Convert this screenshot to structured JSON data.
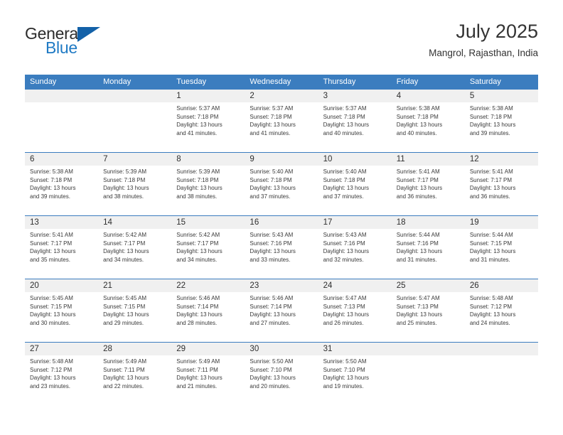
{
  "brand": {
    "name_part1": "General",
    "name_part2": "Blue",
    "triangle_color": "#1361a8",
    "blue_color": "#1f7ac4"
  },
  "header": {
    "title": "July 2025",
    "subtitle": "Mangrol, Rajasthan, India"
  },
  "theme": {
    "header_blue": "#3b7dbf",
    "daynum_band": "#f0f0f0",
    "text": "#333333"
  },
  "weekdays": [
    "Sunday",
    "Monday",
    "Tuesday",
    "Wednesday",
    "Thursday",
    "Friday",
    "Saturday"
  ],
  "weeks": [
    {
      "days": [
        {
          "num": "",
          "sunrise": "",
          "sunset": "",
          "daylight1": "",
          "daylight2": ""
        },
        {
          "num": "",
          "sunrise": "",
          "sunset": "",
          "daylight1": "",
          "daylight2": ""
        },
        {
          "num": "1",
          "sunrise": "Sunrise: 5:37 AM",
          "sunset": "Sunset: 7:18 PM",
          "daylight1": "Daylight: 13 hours",
          "daylight2": "and 41 minutes."
        },
        {
          "num": "2",
          "sunrise": "Sunrise: 5:37 AM",
          "sunset": "Sunset: 7:18 PM",
          "daylight1": "Daylight: 13 hours",
          "daylight2": "and 41 minutes."
        },
        {
          "num": "3",
          "sunrise": "Sunrise: 5:37 AM",
          "sunset": "Sunset: 7:18 PM",
          "daylight1": "Daylight: 13 hours",
          "daylight2": "and 40 minutes."
        },
        {
          "num": "4",
          "sunrise": "Sunrise: 5:38 AM",
          "sunset": "Sunset: 7:18 PM",
          "daylight1": "Daylight: 13 hours",
          "daylight2": "and 40 minutes."
        },
        {
          "num": "5",
          "sunrise": "Sunrise: 5:38 AM",
          "sunset": "Sunset: 7:18 PM",
          "daylight1": "Daylight: 13 hours",
          "daylight2": "and 39 minutes."
        }
      ]
    },
    {
      "days": [
        {
          "num": "6",
          "sunrise": "Sunrise: 5:38 AM",
          "sunset": "Sunset: 7:18 PM",
          "daylight1": "Daylight: 13 hours",
          "daylight2": "and 39 minutes."
        },
        {
          "num": "7",
          "sunrise": "Sunrise: 5:39 AM",
          "sunset": "Sunset: 7:18 PM",
          "daylight1": "Daylight: 13 hours",
          "daylight2": "and 38 minutes."
        },
        {
          "num": "8",
          "sunrise": "Sunrise: 5:39 AM",
          "sunset": "Sunset: 7:18 PM",
          "daylight1": "Daylight: 13 hours",
          "daylight2": "and 38 minutes."
        },
        {
          "num": "9",
          "sunrise": "Sunrise: 5:40 AM",
          "sunset": "Sunset: 7:18 PM",
          "daylight1": "Daylight: 13 hours",
          "daylight2": "and 37 minutes."
        },
        {
          "num": "10",
          "sunrise": "Sunrise: 5:40 AM",
          "sunset": "Sunset: 7:18 PM",
          "daylight1": "Daylight: 13 hours",
          "daylight2": "and 37 minutes."
        },
        {
          "num": "11",
          "sunrise": "Sunrise: 5:41 AM",
          "sunset": "Sunset: 7:17 PM",
          "daylight1": "Daylight: 13 hours",
          "daylight2": "and 36 minutes."
        },
        {
          "num": "12",
          "sunrise": "Sunrise: 5:41 AM",
          "sunset": "Sunset: 7:17 PM",
          "daylight1": "Daylight: 13 hours",
          "daylight2": "and 36 minutes."
        }
      ]
    },
    {
      "days": [
        {
          "num": "13",
          "sunrise": "Sunrise: 5:41 AM",
          "sunset": "Sunset: 7:17 PM",
          "daylight1": "Daylight: 13 hours",
          "daylight2": "and 35 minutes."
        },
        {
          "num": "14",
          "sunrise": "Sunrise: 5:42 AM",
          "sunset": "Sunset: 7:17 PM",
          "daylight1": "Daylight: 13 hours",
          "daylight2": "and 34 minutes."
        },
        {
          "num": "15",
          "sunrise": "Sunrise: 5:42 AM",
          "sunset": "Sunset: 7:17 PM",
          "daylight1": "Daylight: 13 hours",
          "daylight2": "and 34 minutes."
        },
        {
          "num": "16",
          "sunrise": "Sunrise: 5:43 AM",
          "sunset": "Sunset: 7:16 PM",
          "daylight1": "Daylight: 13 hours",
          "daylight2": "and 33 minutes."
        },
        {
          "num": "17",
          "sunrise": "Sunrise: 5:43 AM",
          "sunset": "Sunset: 7:16 PM",
          "daylight1": "Daylight: 13 hours",
          "daylight2": "and 32 minutes."
        },
        {
          "num": "18",
          "sunrise": "Sunrise: 5:44 AM",
          "sunset": "Sunset: 7:16 PM",
          "daylight1": "Daylight: 13 hours",
          "daylight2": "and 31 minutes."
        },
        {
          "num": "19",
          "sunrise": "Sunrise: 5:44 AM",
          "sunset": "Sunset: 7:15 PM",
          "daylight1": "Daylight: 13 hours",
          "daylight2": "and 31 minutes."
        }
      ]
    },
    {
      "days": [
        {
          "num": "20",
          "sunrise": "Sunrise: 5:45 AM",
          "sunset": "Sunset: 7:15 PM",
          "daylight1": "Daylight: 13 hours",
          "daylight2": "and 30 minutes."
        },
        {
          "num": "21",
          "sunrise": "Sunrise: 5:45 AM",
          "sunset": "Sunset: 7:15 PM",
          "daylight1": "Daylight: 13 hours",
          "daylight2": "and 29 minutes."
        },
        {
          "num": "22",
          "sunrise": "Sunrise: 5:46 AM",
          "sunset": "Sunset: 7:14 PM",
          "daylight1": "Daylight: 13 hours",
          "daylight2": "and 28 minutes."
        },
        {
          "num": "23",
          "sunrise": "Sunrise: 5:46 AM",
          "sunset": "Sunset: 7:14 PM",
          "daylight1": "Daylight: 13 hours",
          "daylight2": "and 27 minutes."
        },
        {
          "num": "24",
          "sunrise": "Sunrise: 5:47 AM",
          "sunset": "Sunset: 7:13 PM",
          "daylight1": "Daylight: 13 hours",
          "daylight2": "and 26 minutes."
        },
        {
          "num": "25",
          "sunrise": "Sunrise: 5:47 AM",
          "sunset": "Sunset: 7:13 PM",
          "daylight1": "Daylight: 13 hours",
          "daylight2": "and 25 minutes."
        },
        {
          "num": "26",
          "sunrise": "Sunrise: 5:48 AM",
          "sunset": "Sunset: 7:12 PM",
          "daylight1": "Daylight: 13 hours",
          "daylight2": "and 24 minutes."
        }
      ]
    },
    {
      "days": [
        {
          "num": "27",
          "sunrise": "Sunrise: 5:48 AM",
          "sunset": "Sunset: 7:12 PM",
          "daylight1": "Daylight: 13 hours",
          "daylight2": "and 23 minutes."
        },
        {
          "num": "28",
          "sunrise": "Sunrise: 5:49 AM",
          "sunset": "Sunset: 7:11 PM",
          "daylight1": "Daylight: 13 hours",
          "daylight2": "and 22 minutes."
        },
        {
          "num": "29",
          "sunrise": "Sunrise: 5:49 AM",
          "sunset": "Sunset: 7:11 PM",
          "daylight1": "Daylight: 13 hours",
          "daylight2": "and 21 minutes."
        },
        {
          "num": "30",
          "sunrise": "Sunrise: 5:50 AM",
          "sunset": "Sunset: 7:10 PM",
          "daylight1": "Daylight: 13 hours",
          "daylight2": "and 20 minutes."
        },
        {
          "num": "31",
          "sunrise": "Sunrise: 5:50 AM",
          "sunset": "Sunset: 7:10 PM",
          "daylight1": "Daylight: 13 hours",
          "daylight2": "and 19 minutes."
        },
        {
          "num": "",
          "sunrise": "",
          "sunset": "",
          "daylight1": "",
          "daylight2": ""
        },
        {
          "num": "",
          "sunrise": "",
          "sunset": "",
          "daylight1": "",
          "daylight2": ""
        }
      ]
    }
  ]
}
